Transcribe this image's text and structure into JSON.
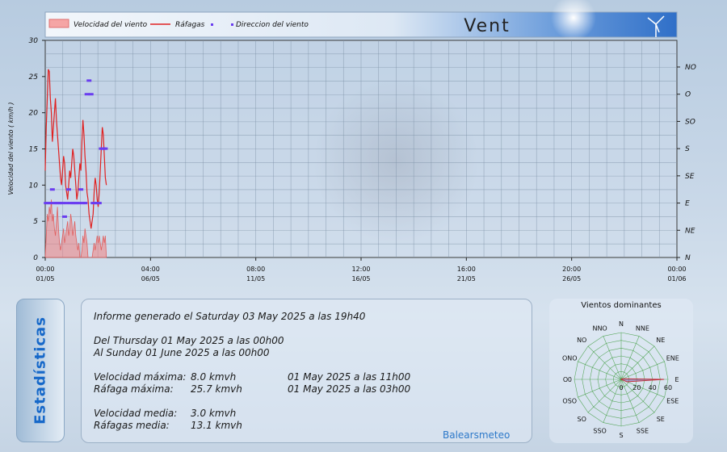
{
  "chart_data": [
    {
      "type": "line",
      "title": "Vent",
      "ylabel": "Velocidad del viento  ( km/h )",
      "ylim": [
        0,
        30
      ],
      "yticks": [
        "0",
        "5",
        "10",
        "15",
        "20",
        "25",
        "30"
      ],
      "y2ticks": [
        "N",
        "NE",
        "E",
        "SE",
        "S",
        "SO",
        "O",
        "NO"
      ],
      "xticks": [
        {
          "time": "00:00",
          "date": "01/05"
        },
        {
          "time": "04:00",
          "date": "06/05"
        },
        {
          "time": "08:00",
          "date": "11/05"
        },
        {
          "time": "12:00",
          "date": "16/05"
        },
        {
          "time": "16:00",
          "date": "21/05"
        },
        {
          "time": "20:00",
          "date": "26/05"
        },
        {
          "time": "00:00",
          "date": "01/06"
        }
      ],
      "xlim_days": [
        0,
        31
      ],
      "grid": true,
      "legend": [
        "Velocidad del viento",
        "Ráfagas",
        "Direccion del viento"
      ],
      "series": [
        {
          "name": "Velocidad del viento",
          "type": "area",
          "color": "#f08080",
          "x": [
            0,
            0.05,
            0.1,
            0.15,
            0.2,
            0.25,
            0.3,
            0.35,
            0.4,
            0.45,
            0.5,
            0.55,
            0.6,
            0.65,
            0.7,
            0.75,
            0.8,
            0.85,
            0.9,
            0.95,
            1.0,
            1.05,
            1.1,
            1.15,
            1.2,
            1.25,
            1.3,
            1.35,
            1.4,
            1.45,
            1.5,
            1.55,
            1.6,
            1.65,
            1.7,
            1.75,
            1.8,
            1.85,
            1.9,
            1.95,
            2.0,
            2.05,
            2.1,
            2.15,
            2.2,
            2.25,
            2.3,
            2.35,
            2.4,
            2.45,
            2.5,
            2.55,
            2.6,
            2.65,
            2.7,
            2.75,
            2.8,
            2.85,
            2.9,
            2.95,
            3.0
          ],
          "values": [
            0,
            3,
            6,
            5,
            7,
            6,
            8,
            5,
            6,
            4,
            3,
            5,
            7,
            4,
            2,
            1,
            2,
            3,
            4,
            2,
            3,
            4,
            5,
            3,
            4,
            6,
            5,
            3,
            4,
            5,
            3,
            2,
            1,
            2,
            0,
            0,
            1,
            3,
            2,
            4,
            3,
            2,
            0,
            0,
            0,
            0,
            0,
            1,
            2,
            1,
            2,
            3,
            2,
            3,
            2,
            1,
            2,
            3,
            2,
            3,
            0
          ]
        },
        {
          "name": "Ráfagas",
          "type": "line",
          "color": "#e02020",
          "x": [
            0,
            0.05,
            0.1,
            0.15,
            0.2,
            0.25,
            0.3,
            0.35,
            0.4,
            0.45,
            0.5,
            0.55,
            0.6,
            0.65,
            0.7,
            0.75,
            0.8,
            0.85,
            0.9,
            0.95,
            1.0,
            1.05,
            1.1,
            1.15,
            1.2,
            1.25,
            1.3,
            1.35,
            1.4,
            1.45,
            1.5,
            1.55,
            1.6,
            1.65,
            1.7,
            1.75,
            1.8,
            1.85,
            1.9,
            1.95,
            2.0,
            2.05,
            2.1,
            2.15,
            2.2,
            2.25,
            2.3,
            2.35,
            2.4,
            2.45,
            2.5,
            2.55,
            2.6,
            2.65,
            2.7,
            2.75,
            2.8,
            2.85,
            2.9,
            2.95,
            3.0
          ],
          "values": [
            12,
            18,
            22,
            26,
            25.7,
            22,
            20,
            16,
            18,
            20,
            22,
            19,
            17,
            15,
            13,
            11,
            10,
            12,
            14,
            13,
            10,
            9,
            8,
            10,
            12,
            11,
            13,
            15,
            14,
            12,
            10,
            8,
            9,
            11,
            13,
            12,
            16,
            19,
            17,
            14,
            12,
            9,
            8,
            6,
            5,
            4,
            5,
            6,
            9,
            11,
            10,
            8,
            7,
            9,
            12,
            15,
            18,
            17,
            14,
            11,
            10
          ]
        },
        {
          "name": "Direccion del viento",
          "type": "scatter",
          "color": "#6a3df0",
          "x": [
            0.05,
            0.15,
            0.25,
            0.35,
            0.45,
            0.55,
            0.65,
            0.75,
            0.85,
            0.95,
            1.05,
            1.15,
            1.25,
            1.35,
            1.45,
            1.55,
            1.65,
            1.75,
            1.85,
            1.95,
            2.05,
            2.15,
            2.25,
            2.35,
            2.45,
            2.55,
            2.65,
            2.75,
            2.85,
            2.95
          ],
          "values": [
            "E",
            "E",
            "E",
            "ESE",
            "E",
            "E",
            "E",
            "E",
            "E",
            "ENE",
            "E",
            "ESE",
            "E",
            "E",
            "E",
            "E",
            "E",
            "ESE",
            "E",
            "E",
            "O",
            "ONO",
            "O",
            "E",
            "E",
            "E",
            "E",
            "S",
            "S",
            "S"
          ]
        }
      ]
    },
    {
      "type": "radar",
      "title": "Vientos dominantes",
      "directions": [
        "N",
        "NNE",
        "NE",
        "ENE",
        "E",
        "ESE",
        "SE",
        "SSE",
        "S",
        "SSO",
        "SO",
        "OSO",
        "O",
        "ONO",
        "NO",
        "NNO"
      ],
      "radial_ticks": [
        "0",
        "20",
        "40",
        "60"
      ],
      "rmax": 60,
      "values": [
        0,
        0,
        0,
        2,
        55,
        8,
        0,
        0,
        0,
        0,
        0,
        0,
        0,
        0,
        0,
        0
      ],
      "color": "#8060b0"
    }
  ],
  "header": {
    "title": "Vent",
    "legend_items": [
      "Velocidad del viento",
      "Ráfagas",
      "Direccion del viento"
    ]
  },
  "stats": {
    "tab_label": "Estadísticas",
    "generated": "Informe generado el Saturday 03 May 2025 a las 19h40",
    "from": "Del Thursday 01 May 2025 a las 00h00",
    "to": "Al Sunday 01 June 2025 a las 00h00",
    "max_speed_label": "Velocidad máxima:",
    "max_speed_value": "8.0 kmvh",
    "max_speed_time": "01 May 2025 a las 11h00",
    "max_gust_label": "Ráfaga máxima:",
    "max_gust_value": "25.7 kmvh",
    "max_gust_time": "01 May 2025 a las 03h00",
    "avg_speed_label": "Velocidad media:",
    "avg_speed_value": "3.0 kmvh",
    "avg_gust_label": "Ráfagas media:",
    "avg_gust_value": "13.1 kmvh",
    "brand": "Balearsmeteo"
  }
}
